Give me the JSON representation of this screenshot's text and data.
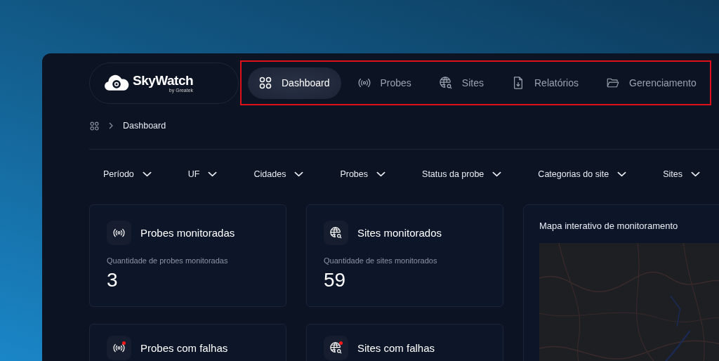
{
  "logo": {
    "name": "SkyWatch",
    "byline": "by Greatek"
  },
  "nav": {
    "highlighted": true,
    "items": [
      {
        "label": "Dashboard",
        "selected": true
      },
      {
        "label": "Probes",
        "selected": false
      },
      {
        "label": "Sites",
        "selected": false
      },
      {
        "label": "Relatórios",
        "selected": false
      },
      {
        "label": "Gerenciamento",
        "selected": false
      }
    ]
  },
  "breadcrumb": {
    "current": "Dashboard"
  },
  "filters": [
    "Período",
    "UF",
    "Cidades",
    "Probes",
    "Status da probe",
    "Categorias do site",
    "Sites"
  ],
  "cards": [
    {
      "title": "Probes monitoradas",
      "subtitle": "Quantidade de probes monitoradas",
      "value": "3",
      "kind": "probe",
      "alert": false
    },
    {
      "title": "Sites monitorados",
      "subtitle": "Quantidade de sites monitorados",
      "value": "59",
      "kind": "site",
      "alert": false
    },
    {
      "title": "Probes com falhas",
      "kind": "probe",
      "alert": true
    },
    {
      "title": "Sites com falhas",
      "kind": "site",
      "alert": true
    }
  ],
  "map": {
    "title": "Mapa interativo de monitoramento",
    "kind": "picture"
  }
}
